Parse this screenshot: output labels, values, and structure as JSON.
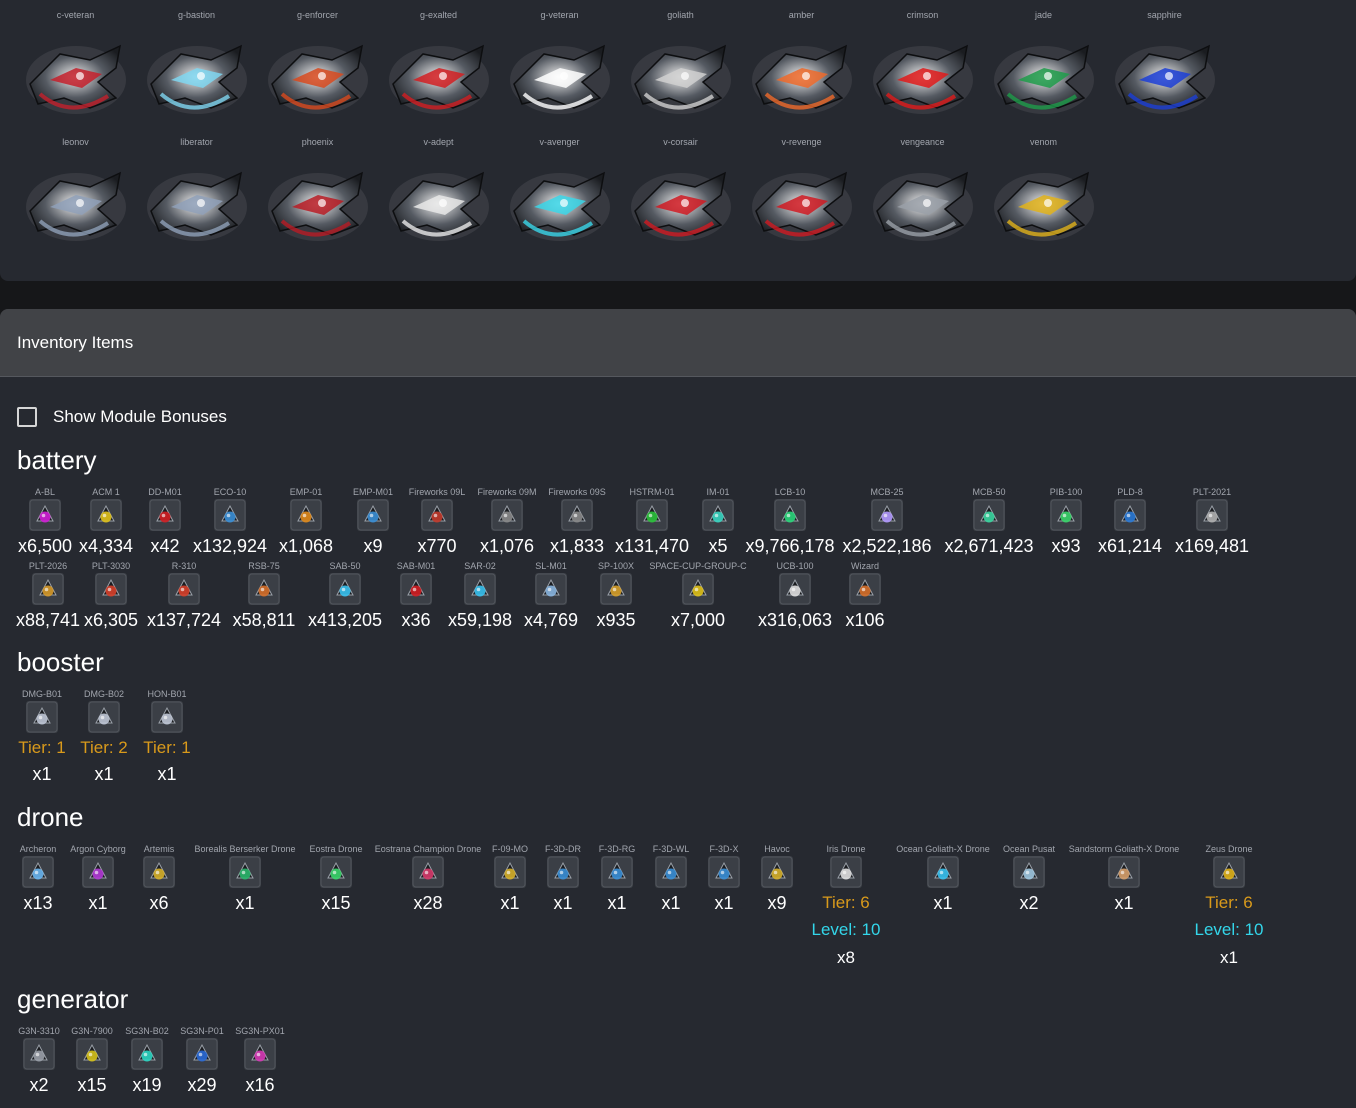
{
  "ships": {
    "row1": [
      {
        "label": "c-veteran",
        "accent": "#c4202c"
      },
      {
        "label": "g-bastion",
        "accent": "#7fd6f0"
      },
      {
        "label": "g-enforcer",
        "accent": "#d84a1e"
      },
      {
        "label": "g-exalted",
        "accent": "#d21e22"
      },
      {
        "label": "g-veteran",
        "accent": "#ffffff"
      },
      {
        "label": "goliath",
        "accent": "#d0d0d0"
      },
      {
        "label": "amber",
        "accent": "#ef6a2a"
      },
      {
        "label": "crimson",
        "accent": "#e01a1a"
      },
      {
        "label": "jade",
        "accent": "#1e9c4a"
      },
      {
        "label": "sapphire",
        "accent": "#1c3ed6"
      }
    ],
    "row2": [
      {
        "label": "leonov",
        "accent": "#8fa0b8"
      },
      {
        "label": "liberator",
        "accent": "#8fa0b8"
      },
      {
        "label": "phoenix",
        "accent": "#b81c24"
      },
      {
        "label": "v-adept",
        "accent": "#e8e8e8"
      },
      {
        "label": "v-avenger",
        "accent": "#39d6e8"
      },
      {
        "label": "v-corsair",
        "accent": "#d01a22"
      },
      {
        "label": "v-revenge",
        "accent": "#d01a22"
      },
      {
        "label": "vengeance",
        "accent": "#9aa0a8"
      },
      {
        "label": "venom",
        "accent": "#e0b21a"
      }
    ]
  },
  "inventory": {
    "title": "Inventory Items",
    "show_bonuses_label": "Show Module Bonuses",
    "categories": {
      "battery": {
        "title": "battery",
        "row1": [
          {
            "label": "A-BL",
            "qty": "x6,500",
            "color": "#d21ed6"
          },
          {
            "label": "ACM 1",
            "qty": "x4,334",
            "color": "#e0c21a"
          },
          {
            "label": "DD-M01",
            "qty": "x42",
            "color": "#d21e22"
          },
          {
            "label": "ECO-10",
            "qty": "x132,924",
            "color": "#3a8fd6"
          },
          {
            "label": "EMP-01",
            "qty": "x1,068",
            "color": "#e08a1a"
          },
          {
            "label": "EMP-M01",
            "qty": "x9",
            "color": "#3a8fd6"
          },
          {
            "label": "Fireworks 09L",
            "qty": "x770",
            "color": "#c23a2a"
          },
          {
            "label": "Fireworks 09M",
            "qty": "x1,076",
            "color": "#8a8a8a"
          },
          {
            "label": "Fireworks 09S",
            "qty": "x1,833",
            "color": "#8a8a8a"
          },
          {
            "label": "HSTRM-01",
            "qty": "x131,470",
            "color": "#2ac23a"
          },
          {
            "label": "IM-01",
            "qty": "x5",
            "color": "#39d6c2"
          },
          {
            "label": "LCB-10",
            "qty": "x9,766,178",
            "color": "#2ad67a"
          },
          {
            "label": "MCB-25",
            "qty": "x2,522,186",
            "color": "#b29aff"
          },
          {
            "label": "MCB-50",
            "qty": "x2,671,423",
            "color": "#3ad6a0"
          },
          {
            "label": "PIB-100",
            "qty": "x93",
            "color": "#3ad66a"
          },
          {
            "label": "PLD-8",
            "qty": "x61,214",
            "color": "#2a7ad6"
          },
          {
            "label": "PLT-2021",
            "qty": "x169,481",
            "color": "#b0b0b0"
          }
        ],
        "row2": [
          {
            "label": "PLT-2026",
            "qty": "x88,741",
            "color": "#d69a2a"
          },
          {
            "label": "PLT-3030",
            "qty": "x6,305",
            "color": "#d6402a"
          },
          {
            "label": "R-310",
            "qty": "x137,724",
            "color": "#d6402a"
          },
          {
            "label": "RSB-75",
            "qty": "x58,811",
            "color": "#d6702a"
          },
          {
            "label": "SAB-50",
            "qty": "x413,205",
            "color": "#39c2f0"
          },
          {
            "label": "SAB-M01",
            "qty": "x36",
            "color": "#d21e22"
          },
          {
            "label": "SAR-02",
            "qty": "x59,198",
            "color": "#39c2f0"
          },
          {
            "label": "SL-M01",
            "qty": "x4,769",
            "color": "#8ab6e0"
          },
          {
            "label": "SP-100X",
            "qty": "x935",
            "color": "#d6a02a"
          },
          {
            "label": "SPACE-CUP-GROUP-C",
            "qty": "x7,000",
            "color": "#e0c21a"
          },
          {
            "label": "UCB-100",
            "qty": "x316,063",
            "color": "#e0e0e0"
          },
          {
            "label": "Wizard",
            "qty": "x106",
            "color": "#d6702a"
          }
        ]
      },
      "booster": {
        "title": "booster",
        "items": [
          {
            "label": "DMG-B01",
            "tier": "Tier: 1",
            "qty": "x1",
            "color": "#c0c8d6"
          },
          {
            "label": "DMG-B02",
            "tier": "Tier: 2",
            "qty": "x1",
            "color": "#c0c8d6"
          },
          {
            "label": "HON-B01",
            "tier": "Tier: 1",
            "qty": "x1",
            "color": "#c0c8d6"
          }
        ]
      },
      "drone": {
        "title": "drone",
        "items": [
          {
            "label": "Archeron",
            "qty": "x13",
            "color": "#6ab6f0"
          },
          {
            "label": "Argon Cyborg",
            "qty": "x1",
            "color": "#b23ad6"
          },
          {
            "label": "Artemis",
            "qty": "x6",
            "color": "#d6b02a"
          },
          {
            "label": "Borealis Berserker Drone",
            "qty": "x1",
            "color": "#2ab66a"
          },
          {
            "label": "Eostra Drone",
            "qty": "x15",
            "color": "#3ad66a"
          },
          {
            "label": "Eostrana Champion Drone",
            "qty": "x28",
            "color": "#d63a6a"
          },
          {
            "label": "F-09-MO",
            "qty": "x1",
            "color": "#d6b02a"
          },
          {
            "label": "F-3D-DR",
            "qty": "x1",
            "color": "#3a8fd6"
          },
          {
            "label": "F-3D-RG",
            "qty": "x1",
            "color": "#3a8fd6"
          },
          {
            "label": "F-3D-WL",
            "qty": "x1",
            "color": "#3a8fd6"
          },
          {
            "label": "F-3D-X",
            "qty": "x1",
            "color": "#3a8fd6"
          },
          {
            "label": "Havoc",
            "qty": "x9",
            "color": "#d6b02a"
          },
          {
            "label": "Iris Drone",
            "tier": "Tier: 6",
            "level": "Level: 10",
            "qty": "x8",
            "color": "#e0e0e0"
          },
          {
            "label": "Ocean Goliath-X Drone",
            "qty": "x1",
            "color": "#39c2f0"
          },
          {
            "label": "Ocean Pusat",
            "qty": "x2",
            "color": "#a0c8e0"
          },
          {
            "label": "Sandstorm Goliath-X Drone",
            "qty": "x1",
            "color": "#d6a06a"
          },
          {
            "label": "Zeus Drone",
            "tier": "Tier: 6",
            "level": "Level: 10",
            "qty": "x1",
            "color": "#e0b21a"
          }
        ]
      },
      "generator": {
        "title": "generator",
        "items": [
          {
            "label": "G3N-3310",
            "qty": "x2",
            "color": "#9aa0a8"
          },
          {
            "label": "G3N-7900",
            "qty": "x15",
            "color": "#d6c21a"
          },
          {
            "label": "SG3N-B02",
            "qty": "x19",
            "color": "#2ad6c2"
          },
          {
            "label": "SG3N-P01",
            "qty": "x29",
            "color": "#2a6ad6"
          },
          {
            "label": "SG3N-PX01",
            "qty": "x16",
            "color": "#d63ab6"
          }
        ]
      }
    }
  }
}
